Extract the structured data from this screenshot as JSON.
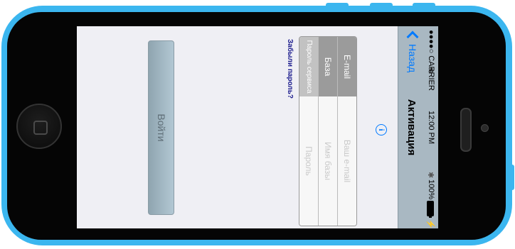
{
  "status_bar": {
    "carrier": "●●●●○ CARRIER",
    "wifi_icon": "wifi-icon",
    "time": "12:00 PM",
    "bluetooth_icon": "bluetooth-icon",
    "battery_percent": "100%",
    "charging_icon": "⚡"
  },
  "nav": {
    "back_label": "Назад",
    "title": "Активация"
  },
  "info_icon": "i",
  "form": {
    "rows": [
      {
        "label": "E-mail",
        "placeholder": "Ваш e-mail"
      },
      {
        "label": "База",
        "placeholder": "Имя базы"
      },
      {
        "label": "Пароль сервиса",
        "placeholder": "Пароль"
      }
    ]
  },
  "forgot_password": "Забыли пароль?",
  "login_button": "Войти",
  "colors": {
    "phone_shell": "#3bb6ef",
    "nav_bar": "#a9b8c2",
    "accent": "#007aff",
    "link": "#1a1a8c",
    "button": "#9fb4bf"
  }
}
